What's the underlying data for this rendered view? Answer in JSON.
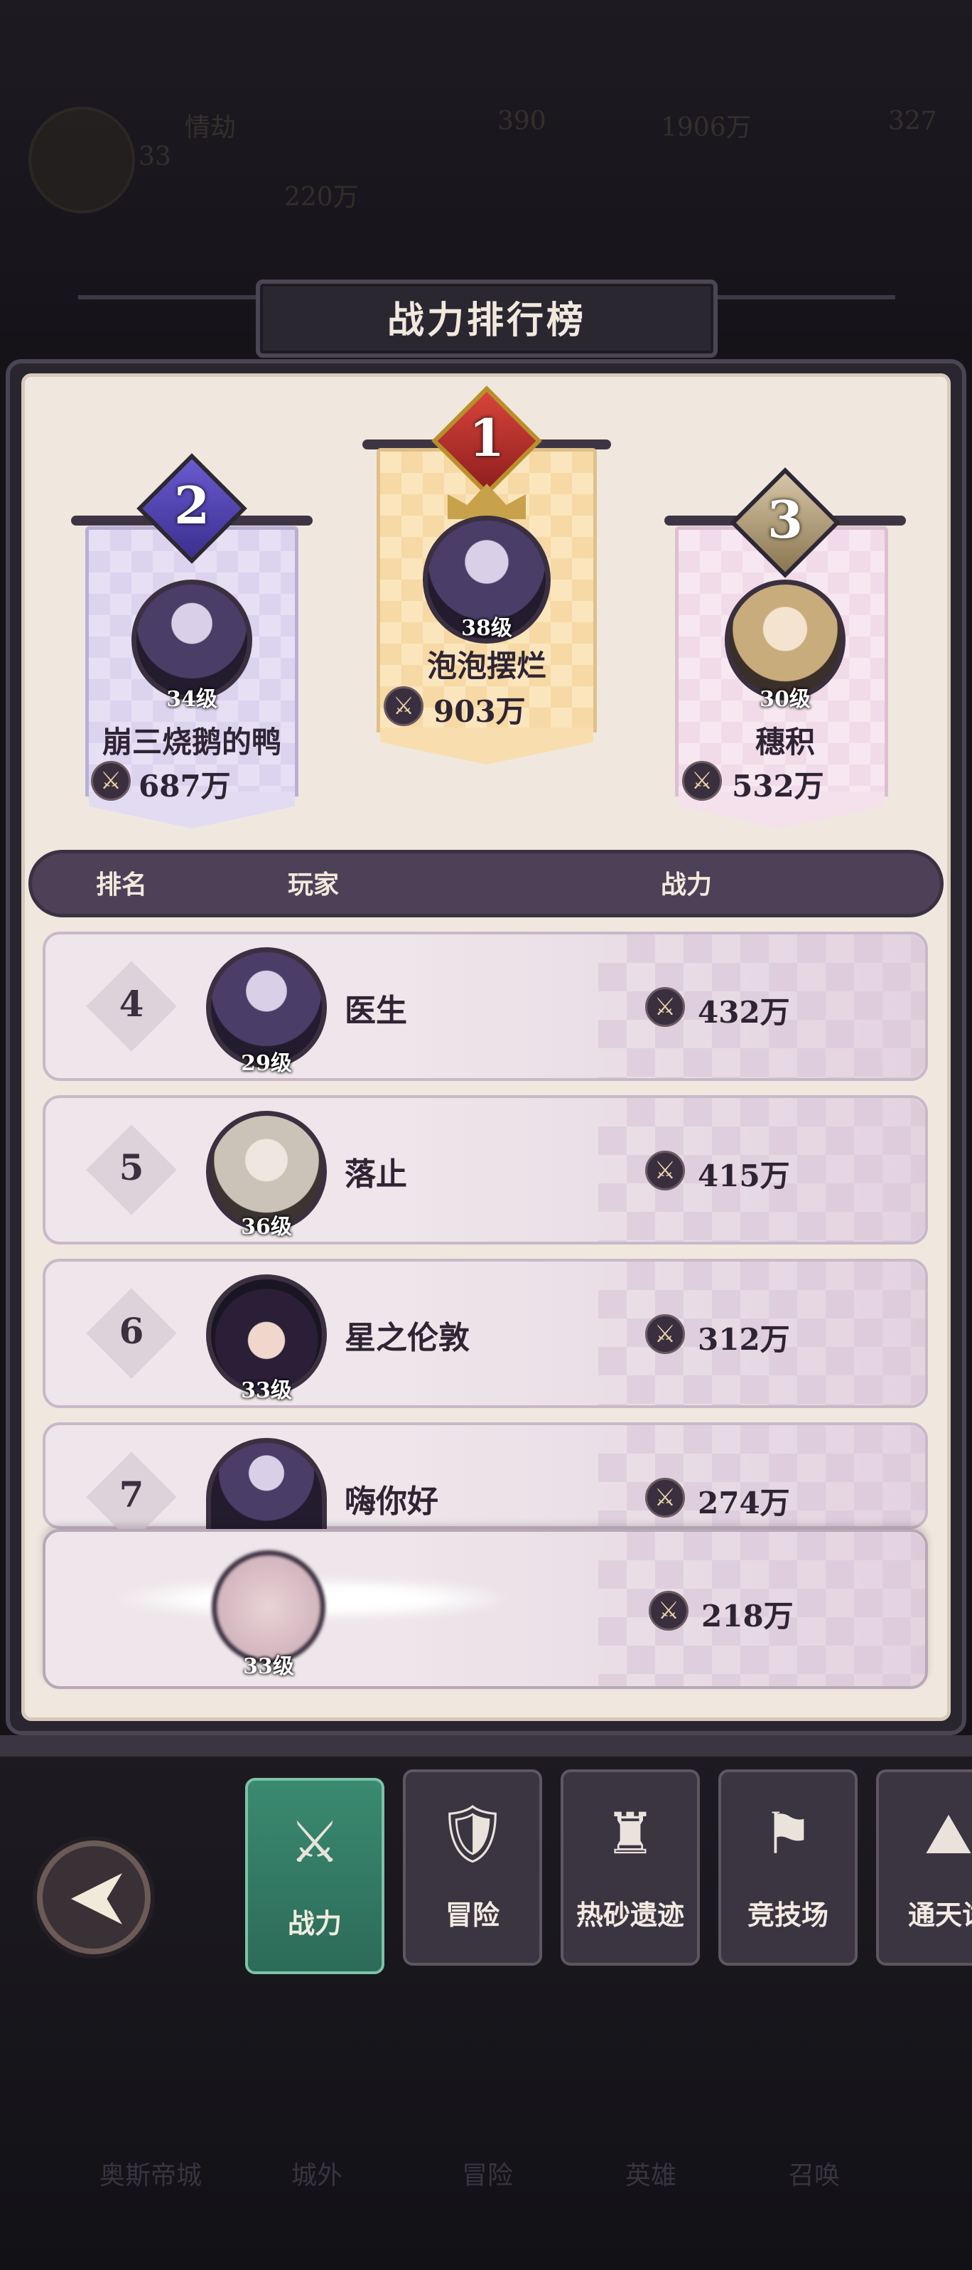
{
  "hud": {
    "level": "33",
    "name": "情劫",
    "res1": "390",
    "res2": "1906万",
    "res3": "327",
    "power": "220万"
  },
  "title": "战力排行榜",
  "podium": [
    {
      "rank": "2",
      "level": "34级",
      "name": "崩三烧鹅的鸭",
      "power": "687万"
    },
    {
      "rank": "1",
      "level": "38级",
      "name": "泡泡摆烂",
      "power": "903万"
    },
    {
      "rank": "3",
      "level": "30级",
      "name": "穗积",
      "power": "532万"
    }
  ],
  "list_header": {
    "rank": "排名",
    "player": "玩家",
    "power": "战力"
  },
  "rows": [
    {
      "rank": "4",
      "level": "29级",
      "name": "医生",
      "power": "432万"
    },
    {
      "rank": "5",
      "level": "36级",
      "name": "落止",
      "power": "415万"
    },
    {
      "rank": "6",
      "level": "33级",
      "name": "星之伦敦",
      "power": "312万"
    },
    {
      "rank": "7",
      "level": "",
      "name": "嗨你好",
      "power": "274万"
    }
  ],
  "self_row": {
    "level": "33级",
    "power": "218万"
  },
  "tabs": [
    {
      "label": "战力",
      "icon": "⚔"
    },
    {
      "label": "冒险",
      "icon": "🛡"
    },
    {
      "label": "热砂遗迹",
      "icon": "♜"
    },
    {
      "label": "竞技场",
      "icon": "⚑"
    },
    {
      "label": "通天试",
      "icon": "⛰"
    }
  ],
  "background_nav": [
    "奥斯帝城",
    "城外",
    "冒险",
    "英雄",
    "召唤"
  ],
  "colors": {
    "active_tab": "#3a8a70",
    "panel": "#f0e8df",
    "header": "#4c4157"
  }
}
